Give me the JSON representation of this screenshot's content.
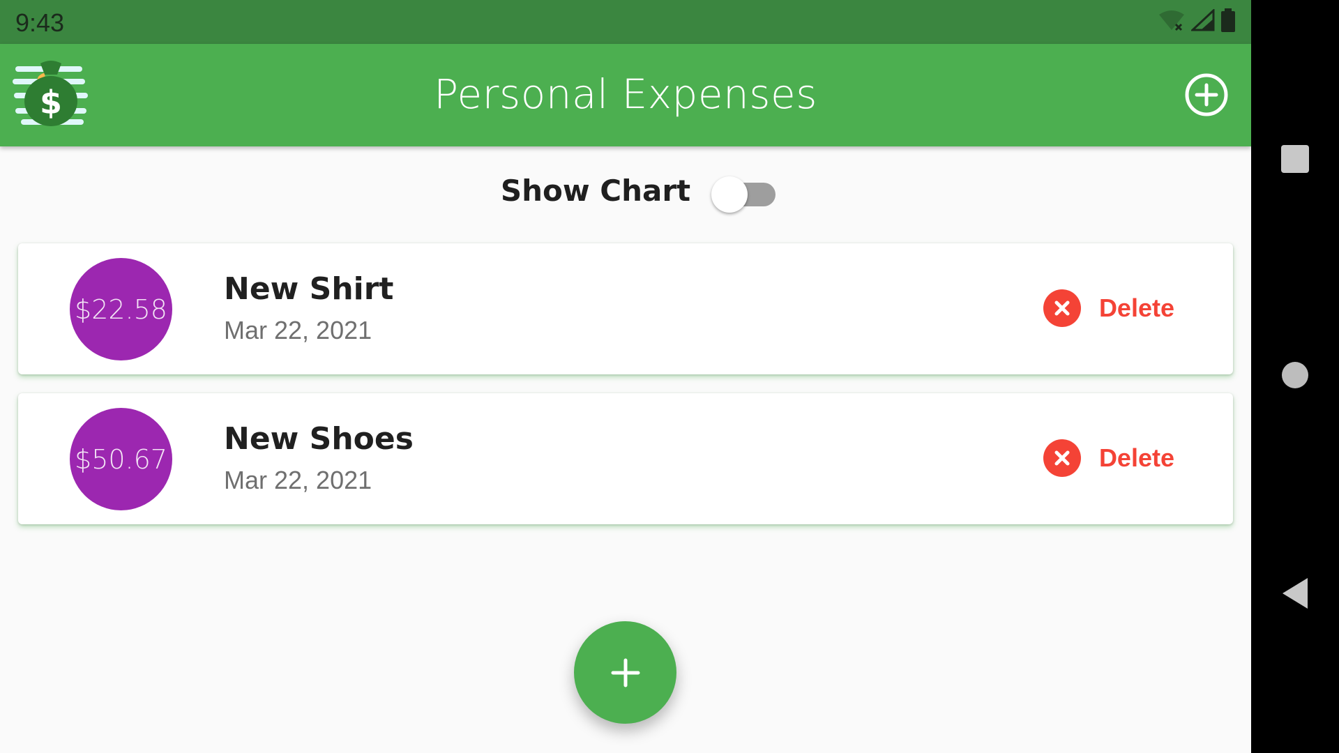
{
  "status_bar": {
    "time": "9:43",
    "icons": [
      "wifi-off-icon",
      "cell-signal-icon",
      "battery-icon"
    ]
  },
  "app_bar": {
    "title": "Personal Expenses",
    "logo_icon": "money-bag-icon",
    "add_icon": "add-circle-icon",
    "color": "#4caf50"
  },
  "toggle": {
    "label": "Show Chart",
    "on": false
  },
  "transactions": [
    {
      "amount": "$22.58",
      "title": "New Shirt",
      "date": "Mar 22, 2021",
      "delete_label": "Delete"
    },
    {
      "amount": "$50.67",
      "title": "New Shoes",
      "date": "Mar 22, 2021",
      "delete_label": "Delete"
    }
  ],
  "fab": {
    "icon": "plus-icon"
  },
  "colors": {
    "primary": "#4caf50",
    "status_bar": "#3b8640",
    "amount_badge": "#9c27b0",
    "delete": "#f44336"
  },
  "nav_bar": {
    "icons": [
      "recents-square-icon",
      "home-circle-icon",
      "back-triangle-icon"
    ]
  }
}
